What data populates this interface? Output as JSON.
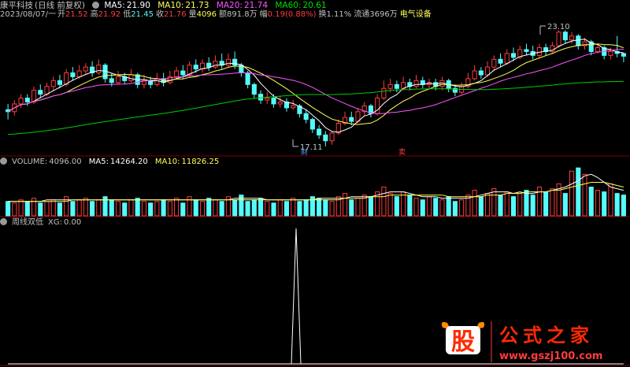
{
  "stock": {
    "name": "康平科技",
    "period": "(日线 前复权)",
    "date": "2023/08/07/一",
    "open_label": "开",
    "open": "21.52",
    "high_label": "高",
    "high": "21.92",
    "low_label": "低",
    "low": "21.45",
    "close_label": "收",
    "close": "21.76",
    "vol_label": "量",
    "vol": "4096",
    "amt_label": "额",
    "amt": "891.8万",
    "chg_label": "幅",
    "chg": "0.19(0.88%)",
    "turn_label": "换",
    "turn": "1.11%",
    "float_label": "流通",
    "float": "3696万",
    "industry": "电气设备"
  },
  "main_ma": {
    "ma5_label": "MA5:",
    "ma5": "21.90",
    "ma10_label": "MA10:",
    "ma10": "21.73",
    "ma20_label": "MA20:",
    "ma20": "21.74",
    "ma60_label": "MA60:",
    "ma60": "20.61"
  },
  "volume_panel": {
    "label": "VOLUME:",
    "value": "4096.00",
    "ma5_label": "MA5:",
    "ma5": "14264.20",
    "ma10_label": "MA10:",
    "ma10": "11826.25"
  },
  "indicator_panel": {
    "name": "周线双低",
    "xg_label": "XG:",
    "xg": "0.00"
  },
  "annotations": {
    "high_marker": "23.10",
    "low_marker": "17.11",
    "event_1": "财",
    "event_2": "卖"
  },
  "watermark": {
    "logo_text": "股",
    "brand": "公式之家",
    "url": "www.gszj100.com"
  },
  "colors": {
    "up": "#ff3c3c",
    "down": "#54fcfc",
    "ma5": "#ffffff",
    "ma10": "#ffff55",
    "ma20": "#ff55ff",
    "ma60": "#00cc00",
    "grid": "#7a0000",
    "label": "#c0c0c0"
  },
  "chart_data": [
    {
      "type": "candlestick",
      "title": "康平科技 (日线 前复权)",
      "candles": [
        [
          19.0,
          18.9,
          19.3,
          18.5
        ],
        [
          18.9,
          19.3,
          19.5,
          18.7
        ],
        [
          19.3,
          19.6,
          19.8,
          19.1
        ],
        [
          19.6,
          19.4,
          19.8,
          19.2
        ],
        [
          19.4,
          20.0,
          20.2,
          19.3
        ],
        [
          20.0,
          19.8,
          20.3,
          19.6
        ],
        [
          19.8,
          20.2,
          20.4,
          19.7
        ],
        [
          20.2,
          20.5,
          20.7,
          20.0
        ],
        [
          20.5,
          20.3,
          20.8,
          20.1
        ],
        [
          20.3,
          20.9,
          21.1,
          20.2
        ],
        [
          20.9,
          20.7,
          21.2,
          20.5
        ],
        [
          20.7,
          21.0,
          21.3,
          20.6
        ],
        [
          21.0,
          21.2,
          21.4,
          20.8
        ],
        [
          21.2,
          20.9,
          21.5,
          20.7
        ],
        [
          20.9,
          21.3,
          21.6,
          20.8
        ],
        [
          21.3,
          20.6,
          21.4,
          20.4
        ],
        [
          20.6,
          20.4,
          20.9,
          20.2
        ],
        [
          20.4,
          20.7,
          21.0,
          20.3
        ],
        [
          20.7,
          20.5,
          20.9,
          20.3
        ],
        [
          20.5,
          20.8,
          21.1,
          20.4
        ],
        [
          20.8,
          20.3,
          20.9,
          20.1
        ],
        [
          20.3,
          20.5,
          20.8,
          20.1
        ],
        [
          20.5,
          20.3,
          20.7,
          20.1
        ],
        [
          20.3,
          20.6,
          20.9,
          20.2
        ],
        [
          20.6,
          20.4,
          20.9,
          20.2
        ],
        [
          20.4,
          20.7,
          21.0,
          20.3
        ],
        [
          20.7,
          21.0,
          21.2,
          20.6
        ],
        [
          21.0,
          20.8,
          21.3,
          20.6
        ],
        [
          20.8,
          21.3,
          21.5,
          20.7
        ],
        [
          21.3,
          21.1,
          21.6,
          20.9
        ],
        [
          21.1,
          21.4,
          21.6,
          20.9
        ],
        [
          21.4,
          21.2,
          21.7,
          21.0
        ],
        [
          21.2,
          21.5,
          21.8,
          21.1
        ],
        [
          21.5,
          21.3,
          21.9,
          21.1
        ],
        [
          21.3,
          21.6,
          21.9,
          21.2
        ],
        [
          21.6,
          21.3,
          22.0,
          21.1
        ],
        [
          21.3,
          20.9,
          21.4,
          20.7
        ],
        [
          20.9,
          20.3,
          21.0,
          20.1
        ],
        [
          20.3,
          19.8,
          20.4,
          19.6
        ],
        [
          19.8,
          19.5,
          20.0,
          19.3
        ],
        [
          19.5,
          19.6,
          19.9,
          19.3
        ],
        [
          19.6,
          19.3,
          19.8,
          19.1
        ],
        [
          19.3,
          19.4,
          19.7,
          19.1
        ],
        [
          19.4,
          19.1,
          19.6,
          18.9
        ],
        [
          19.1,
          19.2,
          19.5,
          19.0
        ],
        [
          19.2,
          18.8,
          19.3,
          18.6
        ],
        [
          18.8,
          18.5,
          19.0,
          18.3
        ],
        [
          18.5,
          18.0,
          18.6,
          17.8
        ],
        [
          18.0,
          17.7,
          18.2,
          17.5
        ],
        [
          17.7,
          17.4,
          17.9,
          17.11
        ],
        [
          17.4,
          17.8,
          17.9,
          17.2
        ],
        [
          17.8,
          18.3,
          18.5,
          17.7
        ],
        [
          18.3,
          18.6,
          18.9,
          18.2
        ],
        [
          18.6,
          18.4,
          18.9,
          18.2
        ],
        [
          18.4,
          18.9,
          19.1,
          18.3
        ],
        [
          18.9,
          19.2,
          19.4,
          18.7
        ],
        [
          19.2,
          18.8,
          19.3,
          18.6
        ],
        [
          18.8,
          19.6,
          19.8,
          18.7
        ],
        [
          19.6,
          20.1,
          20.5,
          19.5
        ],
        [
          20.1,
          20.3,
          20.6,
          19.9
        ],
        [
          20.3,
          20.1,
          20.5,
          19.9
        ],
        [
          20.1,
          20.4,
          20.7,
          20.0
        ],
        [
          20.4,
          20.2,
          20.6,
          20.0
        ],
        [
          20.2,
          20.5,
          20.8,
          20.1
        ],
        [
          20.5,
          20.3,
          20.7,
          20.1
        ],
        [
          20.3,
          20.4,
          20.6,
          20.1
        ],
        [
          20.4,
          20.2,
          20.6,
          20.0
        ],
        [
          20.2,
          20.5,
          20.7,
          20.0
        ],
        [
          20.5,
          20.1,
          20.6,
          19.9
        ],
        [
          20.1,
          19.9,
          20.3,
          19.7
        ],
        [
          19.9,
          20.2,
          20.4,
          19.8
        ],
        [
          20.2,
          20.6,
          20.9,
          20.1
        ],
        [
          20.6,
          21.0,
          21.3,
          20.5
        ],
        [
          21.0,
          20.8,
          21.2,
          20.6
        ],
        [
          20.8,
          21.2,
          21.5,
          20.7
        ],
        [
          21.2,
          21.6,
          21.8,
          21.0
        ],
        [
          21.6,
          21.4,
          21.9,
          21.2
        ],
        [
          21.4,
          21.9,
          22.1,
          21.3
        ],
        [
          21.9,
          21.7,
          22.2,
          21.5
        ],
        [
          21.7,
          22.1,
          22.3,
          21.6
        ],
        [
          22.1,
          22.0,
          22.4,
          21.8
        ],
        [
          22.0,
          21.8,
          22.3,
          21.6
        ],
        [
          21.8,
          22.2,
          22.4,
          21.7
        ],
        [
          22.2,
          22.0,
          22.4,
          21.8
        ],
        [
          22.0,
          22.3,
          22.5,
          21.9
        ],
        [
          22.3,
          23.0,
          23.1,
          22.2
        ],
        [
          23.0,
          22.6,
          23.1,
          22.4
        ],
        [
          22.6,
          22.8,
          23.0,
          22.4
        ],
        [
          22.8,
          22.3,
          22.9,
          22.1
        ],
        [
          22.3,
          22.5,
          22.7,
          22.1
        ],
        [
          22.5,
          22.0,
          22.6,
          21.8
        ],
        [
          22.0,
          22.2,
          22.4,
          21.9
        ],
        [
          22.2,
          21.8,
          22.3,
          21.6
        ],
        [
          21.8,
          22.0,
          22.2,
          21.6
        ],
        [
          22.0,
          21.9,
          22.8,
          21.7
        ],
        [
          21.9,
          21.76,
          21.92,
          21.45
        ]
      ],
      "series_names": [
        "MA5",
        "MA10",
        "MA20",
        "MA60"
      ],
      "ylim": [
        16.7,
        23.6
      ]
    },
    {
      "type": "bar",
      "title": "VOLUME",
      "values": [
        9,
        8,
        10,
        9,
        11,
        8,
        9,
        10,
        8,
        12,
        9,
        10,
        11,
        9,
        10,
        12,
        10,
        9,
        8,
        10,
        11,
        9,
        8,
        9,
        10,
        9,
        11,
        8,
        12,
        10,
        9,
        11,
        10,
        9,
        12,
        10,
        13,
        9,
        10,
        11,
        9,
        8,
        10,
        9,
        11,
        9,
        10,
        12,
        11,
        10,
        9,
        12,
        14,
        10,
        11,
        13,
        12,
        15,
        18,
        14,
        12,
        15,
        13,
        11,
        10,
        12,
        11,
        10,
        12,
        9,
        10,
        13,
        16,
        12,
        14,
        17,
        13,
        15,
        12,
        14,
        16,
        13,
        18,
        15,
        17,
        20,
        14,
        28,
        30,
        26,
        18,
        16,
        15,
        20,
        14,
        13
      ],
      "ma5": [
        9,
        9,
        9,
        9,
        9,
        9,
        10,
        10,
        10,
        10,
        10,
        10,
        10,
        10,
        10,
        10,
        10,
        10,
        10,
        10,
        10,
        10,
        10,
        10,
        10,
        10,
        10,
        10,
        10,
        10,
        10,
        10,
        10,
        10,
        10,
        11,
        11,
        11,
        11,
        11,
        10,
        10,
        10,
        10,
        10,
        10,
        10,
        10,
        11,
        11,
        11,
        11,
        11,
        12,
        12,
        12,
        12,
        13,
        14,
        15,
        15,
        15,
        14,
        13,
        12,
        12,
        12,
        11,
        11,
        11,
        11,
        11,
        12,
        13,
        14,
        15,
        15,
        15,
        14,
        15,
        14,
        14,
        15,
        15,
        16,
        17,
        18,
        20,
        22,
        25,
        26,
        24,
        21,
        18,
        17,
        16
      ],
      "ma10": [
        9,
        9,
        9,
        9,
        9,
        9,
        9,
        9,
        9,
        9,
        10,
        10,
        10,
        10,
        10,
        10,
        10,
        10,
        10,
        10,
        10,
        10,
        10,
        10,
        10,
        10,
        10,
        10,
        10,
        10,
        10,
        10,
        10,
        10,
        10,
        10,
        10,
        10,
        10,
        10,
        10,
        10,
        10,
        10,
        10,
        10,
        10,
        10,
        10,
        10,
        10,
        10,
        11,
        11,
        11,
        11,
        12,
        12,
        12,
        13,
        13,
        13,
        13,
        13,
        13,
        13,
        13,
        13,
        12,
        12,
        12,
        12,
        12,
        12,
        13,
        13,
        13,
        14,
        14,
        14,
        15,
        15,
        15,
        15,
        16,
        16,
        17,
        18,
        19,
        20,
        21,
        21,
        21,
        20,
        19,
        18
      ]
    },
    {
      "type": "line",
      "title": "周线双低",
      "series": [
        {
          "name": "XG",
          "values": [
            0,
            0,
            0,
            0,
            0,
            0,
            0,
            0,
            0,
            0,
            0,
            0,
            0,
            0,
            0,
            0,
            0,
            0,
            0,
            0,
            0,
            0,
            0,
            0,
            0,
            0,
            0,
            0,
            0,
            0,
            0,
            0,
            0,
            0,
            0,
            0,
            0,
            0,
            0,
            0,
            0,
            0,
            0,
            0,
            0,
            0,
            0,
            0,
            0,
            0,
            0,
            0,
            0,
            0,
            0,
            0,
            0,
            0,
            0,
            0,
            0,
            0,
            0,
            0,
            0,
            0,
            0,
            0,
            0,
            0,
            0,
            0,
            0,
            0,
            0,
            0,
            0,
            0,
            0,
            0,
            0,
            0,
            0,
            0,
            0,
            0,
            0,
            0,
            0,
            0,
            0,
            0,
            0,
            0,
            0,
            0
          ]
        }
      ],
      "ylim": [
        0,
        1
      ]
    }
  ]
}
